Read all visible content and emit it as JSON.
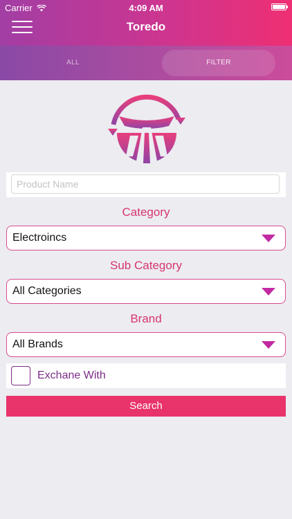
{
  "status_bar": {
    "carrier": "Carrier",
    "time": "4:09 AM"
  },
  "nav": {
    "title": "Toredo"
  },
  "tabs": [
    {
      "label": "ALL"
    },
    {
      "label": "FILTER"
    }
  ],
  "filter": {
    "product_name_placeholder": "Product Name",
    "category_label": "Category",
    "category_value": "Electroincs",
    "subcategory_label": "Sub Category",
    "subcategory_value": "All Categories",
    "brand_label": "Brand",
    "brand_value": "All Brands",
    "exchange_label": "Exchane With",
    "search_label": "Search"
  },
  "colors": {
    "accent": "#d8356f",
    "dropdown_caret": "#c12aa2",
    "search_button": "#e8336b",
    "exchange_text": "#7b2d86"
  }
}
